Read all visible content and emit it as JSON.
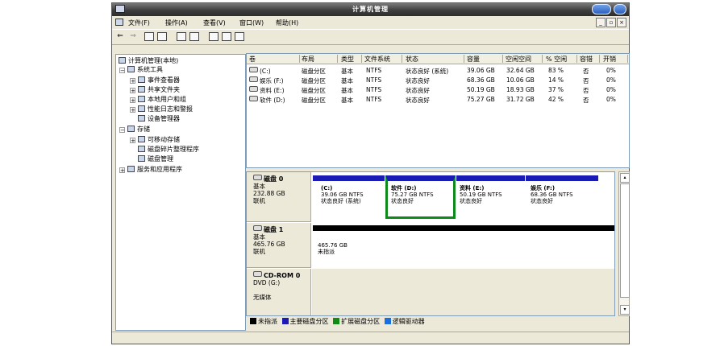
{
  "window": {
    "title": "计算机管理"
  },
  "menu": [
    "文件(F)",
    "操作(A)",
    "查看(V)",
    "窗口(W)",
    "帮助(H)"
  ],
  "toolbar": {
    "back": "⇐",
    "forward": "⇒"
  },
  "tree": [
    {
      "label": "计算机管理(本地)",
      "level": 0,
      "expand": ""
    },
    {
      "label": "系统工具",
      "level": 1,
      "expand": "−"
    },
    {
      "label": "事件查看器",
      "level": 2,
      "expand": "+"
    },
    {
      "label": "共享文件夹",
      "level": 2,
      "expand": "+"
    },
    {
      "label": "本地用户和组",
      "level": 2,
      "expand": "+"
    },
    {
      "label": "性能日志和警报",
      "level": 2,
      "expand": "+"
    },
    {
      "label": "设备管理器",
      "level": 2,
      "expand": ""
    },
    {
      "label": "存储",
      "level": 1,
      "expand": "−"
    },
    {
      "label": "可移动存储",
      "level": 2,
      "expand": "+"
    },
    {
      "label": "磁盘碎片整理程序",
      "level": 2,
      "expand": ""
    },
    {
      "label": "磁盘管理",
      "level": 2,
      "expand": ""
    },
    {
      "label": "服务和应用程序",
      "level": 1,
      "expand": "+"
    }
  ],
  "volume_list": {
    "headers": [
      "卷",
      "布局",
      "类型",
      "文件系统",
      "状态",
      "容量",
      "空闲空间",
      "% 空闲",
      "容错",
      "开销"
    ],
    "rows": [
      [
        "(C:)",
        "磁盘分区",
        "基本",
        "NTFS",
        "状态良好 (系统)",
        "39.06 GB",
        "32.64 GB",
        "83 %",
        "否",
        "0%"
      ],
      [
        "娱乐 (F:)",
        "磁盘分区",
        "基本",
        "NTFS",
        "状态良好",
        "68.36 GB",
        "10.06 GB",
        "14 %",
        "否",
        "0%"
      ],
      [
        "资料 (E:)",
        "磁盘分区",
        "基本",
        "NTFS",
        "状态良好",
        "50.19 GB",
        "18.93 GB",
        "37 %",
        "否",
        "0%"
      ],
      [
        "软件 (D:)",
        "磁盘分区",
        "基本",
        "NTFS",
        "状态良好",
        "75.27 GB",
        "31.72 GB",
        "42 %",
        "否",
        "0%"
      ]
    ]
  },
  "disks": [
    {
      "name": "磁盘 0",
      "type": "基本",
      "size": "232.88 GB",
      "status": "联机",
      "partitions": [
        {
          "name": "(C:)",
          "size": "39.06 GB NTFS",
          "status": "状态良好 (系统)"
        },
        {
          "name": "软件 (D:)",
          "size": "75.27 GB NTFS",
          "status": "状态良好"
        },
        {
          "name": "资料 (E:)",
          "size": "50.19 GB NTFS",
          "status": "状态良好"
        },
        {
          "name": "娱乐 (F:)",
          "size": "68.36 GB NTFS",
          "status": "状态良好"
        }
      ]
    },
    {
      "name": "磁盘 1",
      "type": "基本",
      "size": "465.76 GB",
      "status": "联机",
      "partitions": [
        {
          "name": "",
          "size": "465.76 GB",
          "status": "未指派"
        }
      ]
    },
    {
      "name": "CD-ROM 0",
      "type": "DVD (G:)",
      "size": "",
      "status": "无媒体",
      "partitions": []
    }
  ],
  "legend": [
    {
      "label": "未指派",
      "color": "#000000"
    },
    {
      "label": "主要磁盘分区",
      "color": "#1a1ab5"
    },
    {
      "label": "扩展磁盘分区",
      "color": "#138a13"
    },
    {
      "label": "逻辑驱动器",
      "color": "#1a6ee0"
    }
  ],
  "colors": {
    "primary_partition": "#1a1ab5",
    "selection": "#0e8a1a",
    "unallocated": "#000000"
  }
}
